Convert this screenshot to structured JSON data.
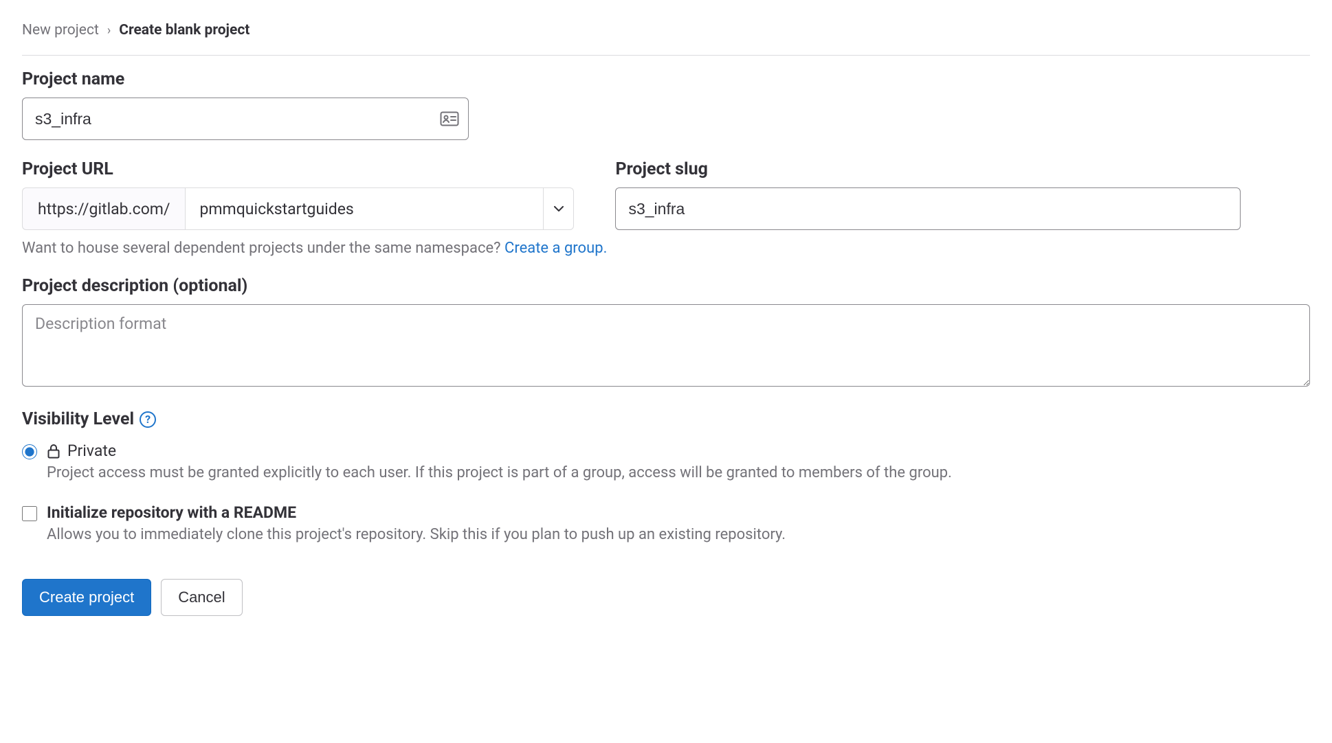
{
  "breadcrumb": {
    "parent": "New project",
    "separator": "›",
    "current": "Create blank project"
  },
  "project_name": {
    "label": "Project name",
    "value": "s3_infra"
  },
  "project_url": {
    "label": "Project URL",
    "prefix": "https://gitlab.com/",
    "namespace": "pmmquickstartguides"
  },
  "project_slug": {
    "label": "Project slug",
    "value": "s3_infra"
  },
  "namespace_help": {
    "text": "Want to house several dependent projects under the same namespace? ",
    "link_text": "Create a group."
  },
  "description": {
    "label": "Project description (optional)",
    "placeholder": "Description format",
    "value": ""
  },
  "visibility": {
    "label": "Visibility Level",
    "option_title": "Private",
    "option_desc": "Project access must be granted explicitly to each user. If this project is part of a group, access will be granted to members of the group."
  },
  "readme": {
    "title": "Initialize repository with a README",
    "desc": "Allows you to immediately clone this project's repository. Skip this if you plan to push up an existing repository."
  },
  "buttons": {
    "create": "Create project",
    "cancel": "Cancel"
  }
}
